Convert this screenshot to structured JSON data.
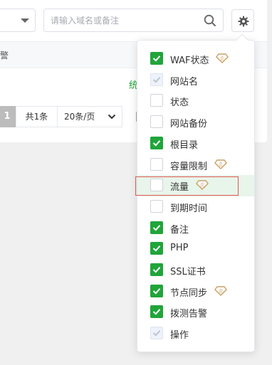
{
  "search": {
    "placeholder": "请输入域名或备注"
  },
  "table": {
    "partial_header": "警",
    "row_action": "统"
  },
  "pagination": {
    "current": "1",
    "total": "共1条",
    "page_size": "20条/页"
  },
  "columns": [
    {
      "label": "WAF状态",
      "checked": true,
      "disabled": false,
      "pro": true
    },
    {
      "label": "网站名",
      "checked": true,
      "disabled": true,
      "pro": false
    },
    {
      "label": "状态",
      "checked": false,
      "disabled": false,
      "pro": false
    },
    {
      "label": "网站备份",
      "checked": false,
      "disabled": false,
      "pro": false
    },
    {
      "label": "根目录",
      "checked": true,
      "disabled": false,
      "pro": false
    },
    {
      "label": "容量限制",
      "checked": false,
      "disabled": false,
      "pro": true
    },
    {
      "label": "流量",
      "checked": false,
      "disabled": false,
      "pro": true
    },
    {
      "label": "到期时间",
      "checked": false,
      "disabled": false,
      "pro": false
    },
    {
      "label": "备注",
      "checked": true,
      "disabled": false,
      "pro": false
    },
    {
      "label": "PHP",
      "checked": true,
      "disabled": false,
      "pro": false
    },
    {
      "label": "SSL证书",
      "checked": true,
      "disabled": false,
      "pro": false
    },
    {
      "label": "节点同步",
      "checked": true,
      "disabled": false,
      "pro": true
    },
    {
      "label": "拨测告警",
      "checked": true,
      "disabled": false,
      "pro": false
    },
    {
      "label": "操作",
      "checked": true,
      "disabled": true,
      "pro": false
    }
  ],
  "highlighted_option": "流量",
  "colors": {
    "accent": "#20a53a",
    "gem": "#c9a063",
    "highlight_border": "#e05a4f"
  },
  "icons": {
    "search": "search-icon",
    "settings": "gear-icon",
    "pro": "gem-icon",
    "check": "checkmark-icon"
  }
}
